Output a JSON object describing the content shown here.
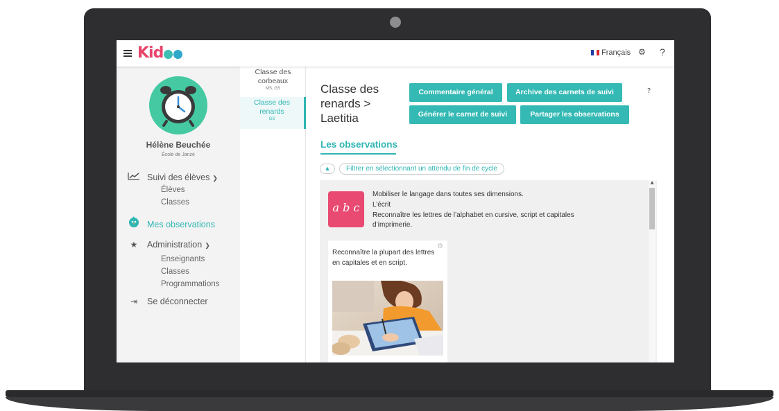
{
  "header": {
    "logo_text": "Kid",
    "language": "Français",
    "help_label": "?"
  },
  "sidebar": {
    "user_name": "Hélène Beuchée",
    "school": "École de Janzé",
    "menu": {
      "suivi": "Suivi des élèves",
      "suivi_sub": [
        "Élèves",
        "Classes"
      ],
      "observations": "Mes observations",
      "administration": "Administration",
      "admin_sub": [
        "Enseignants",
        "Classes",
        "Programmations"
      ],
      "logout": "Se déconnecter"
    }
  },
  "classes": [
    {
      "name": "Classe des corbeaux",
      "levels": "MS, GS",
      "active": false
    },
    {
      "name": "Classe des renards",
      "levels": "GS",
      "active": true
    }
  ],
  "main": {
    "title": "Classe des renards > Laetitia",
    "buttons": {
      "commentaire": "Commentaire général",
      "archive": "Archive des carnets de suivi",
      "generer": "Générer le carnet de suivi",
      "partager": "Partager les observations"
    },
    "help_label": "?",
    "section_title": "Les observations",
    "filter_label": "Filtrer en sélectionnant un attendu de fin de cycle",
    "observation": {
      "tile_text": "a b c",
      "domain": "Mobiliser le langage dans toutes ses dimensions.",
      "subdomain": "L’écrit",
      "objective_line1": "Reconnaître les lettres de l’alphabet en cursive, script et capitales",
      "objective_line2": "d’imprimerie.",
      "card_text": "Reconnaître la plupart des lettres en capitales et en script."
    }
  },
  "colors": {
    "accent": "#34b9b4",
    "brand": "#e8456a",
    "avatar": "#45c9a2",
    "tile": "#e94a72"
  }
}
